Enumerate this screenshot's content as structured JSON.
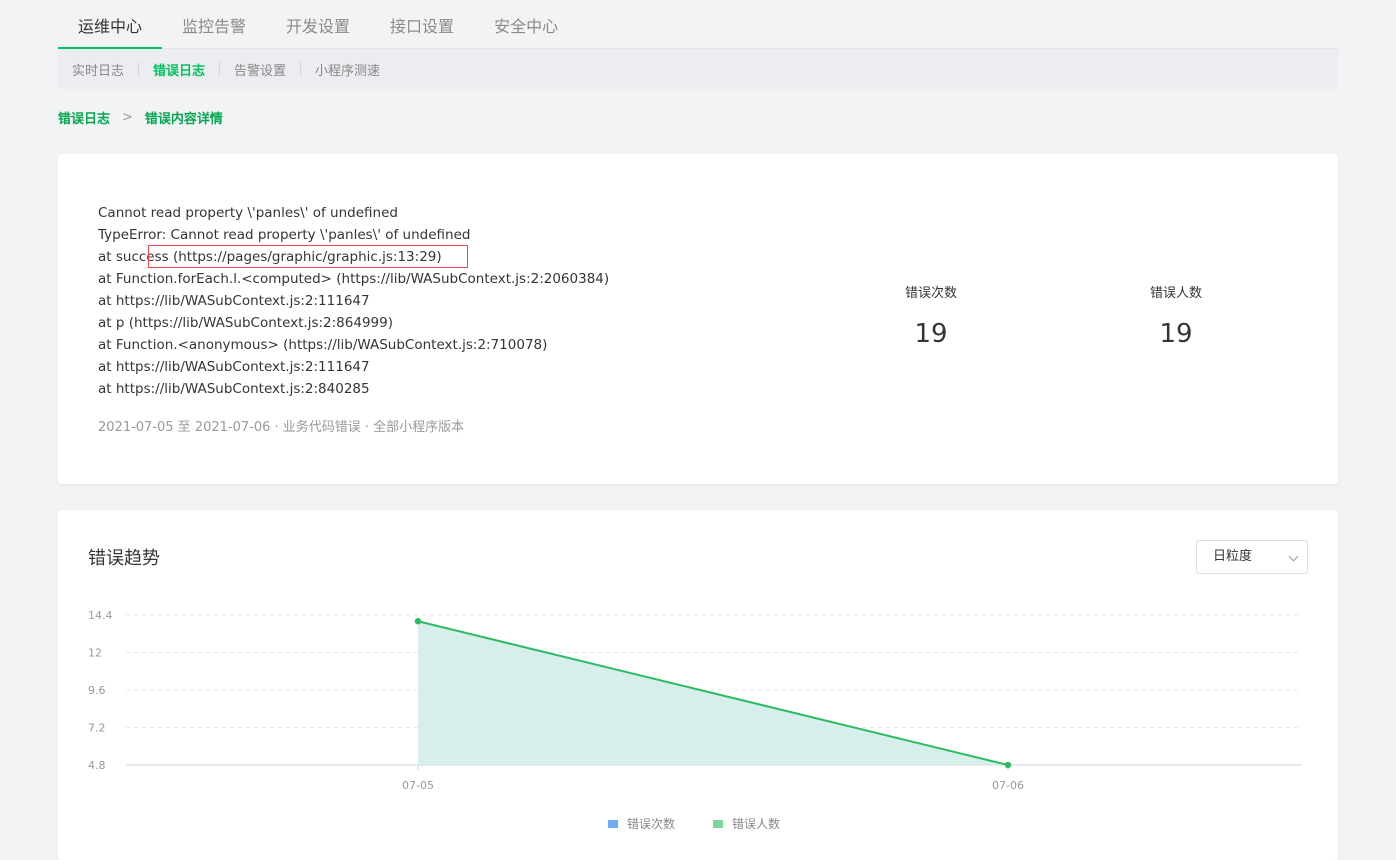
{
  "nav": {
    "tabs": [
      {
        "label": "运维中心"
      },
      {
        "label": "监控告警"
      },
      {
        "label": "开发设置"
      },
      {
        "label": "接口设置"
      },
      {
        "label": "安全中心"
      }
    ],
    "sub_tabs": [
      {
        "label": "实时日志"
      },
      {
        "label": "错误日志"
      },
      {
        "label": "告警设置"
      },
      {
        "label": "小程序测速"
      }
    ]
  },
  "breadcrumb": {
    "parent": "错误日志",
    "current": "错误内容详情",
    "separator": ">"
  },
  "error": {
    "stack_lines": [
      "Cannot read property \\'panles\\' of undefined",
      "TypeError: Cannot read property \\'panles\\' of undefined",
      "at success (https://pages/graphic/graphic.js:13:29)",
      "at Function.forEach.l.<computed> (https://lib/WASubContext.js:2:2060384)",
      "at https://lib/WASubContext.js:2:111647",
      "at p (https://lib/WASubContext.js:2:864999)",
      "at Function.<anonymous> (https://lib/WASubContext.js:2:710078)",
      "at https://lib/WASubContext.js:2:111647",
      "at https://lib/WASubContext.js:2:840285"
    ],
    "meta": "2021-07-05 至  2021-07-06 ·  业务代码错误 ·  全部小程序版本",
    "stats": {
      "count_label": "错误次数",
      "count_value": "19",
      "users_label": "错误人数",
      "users_value": "19"
    }
  },
  "trend": {
    "title": "错误趋势",
    "granularity": "日粒度"
  },
  "colors": {
    "accent": "#07c160",
    "line": "#2dbb5f",
    "area": "#d4eeec",
    "series1": "#6aaef0",
    "series2": "#7fd7a0"
  },
  "chart_data": {
    "type": "area",
    "x": [
      "07-05",
      "07-06"
    ],
    "y_ticks": [
      "14.4",
      "12",
      "9.6",
      "7.2",
      "4.8"
    ],
    "ylim": [
      4.8,
      14.4
    ],
    "series": [
      {
        "name": "错误次数",
        "values": [
          14,
          4.8
        ]
      },
      {
        "name": "错误人数",
        "values": [
          14,
          4.8
        ]
      }
    ],
    "legend": [
      "错误次数",
      "错误人数"
    ],
    "legend_position": "bottom",
    "grid": true
  }
}
